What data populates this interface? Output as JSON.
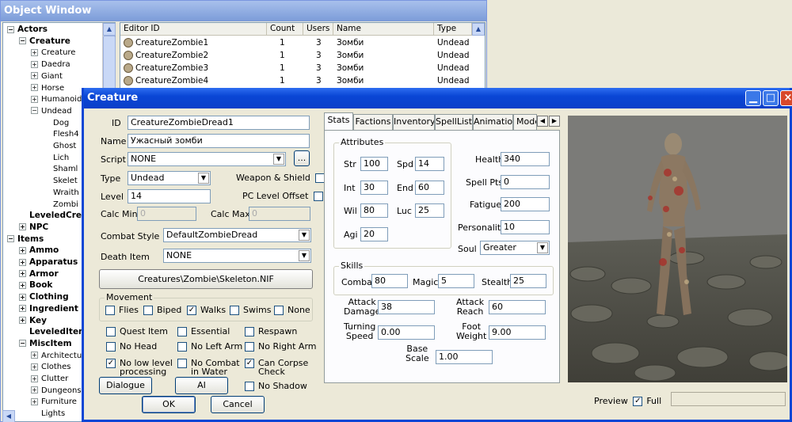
{
  "object_window": {
    "title": "Object Window",
    "tree": [
      {
        "label": "Actors",
        "bold": true,
        "exp": "−"
      },
      {
        "label": "Creature",
        "bold": true,
        "exp": "−"
      },
      {
        "label": "Creature",
        "exp": "+"
      },
      {
        "label": "Daedra",
        "exp": "+"
      },
      {
        "label": "Giant",
        "exp": "+"
      },
      {
        "label": "Horse",
        "exp": "+"
      },
      {
        "label": "Humanoid",
        "exp": "+"
      },
      {
        "label": "Undead",
        "exp": "−"
      },
      {
        "label": "Dog"
      },
      {
        "label": "Flesh4"
      },
      {
        "label": "Ghost"
      },
      {
        "label": "Lich"
      },
      {
        "label": "Shaml"
      },
      {
        "label": "Skelet"
      },
      {
        "label": "Wraith"
      },
      {
        "label": "Zombi"
      },
      {
        "label": "LeveledCrea",
        "bold": true
      },
      {
        "label": "NPC",
        "bold": true,
        "exp": "+"
      },
      {
        "label": "Items",
        "bold": true,
        "exp": "−"
      },
      {
        "label": "Ammo",
        "bold": true,
        "exp": "+"
      },
      {
        "label": "Apparatus",
        "bold": true,
        "exp": "+"
      },
      {
        "label": "Armor",
        "bold": true,
        "exp": "+"
      },
      {
        "label": "Book",
        "bold": true,
        "exp": "+"
      },
      {
        "label": "Clothing",
        "bold": true,
        "exp": "+"
      },
      {
        "label": "Ingredient",
        "bold": true,
        "exp": "+"
      },
      {
        "label": "Key",
        "bold": true,
        "exp": "+"
      },
      {
        "label": "LeveledItem",
        "bold": true
      },
      {
        "label": "MiscItem",
        "bold": true,
        "exp": "−"
      },
      {
        "label": "Architectu",
        "exp": "+"
      },
      {
        "label": "Clothes",
        "exp": "+"
      },
      {
        "label": "Clutter",
        "exp": "+"
      },
      {
        "label": "Dungeons",
        "exp": "+"
      },
      {
        "label": "Furniture",
        "exp": "+"
      },
      {
        "label": "Lights"
      }
    ],
    "columns": [
      "Editor ID",
      "Count",
      "Users",
      "Name",
      "Type"
    ],
    "rows": [
      {
        "id": "CreatureZombie1",
        "count": "1",
        "users": "3",
        "name": "Зомби",
        "type": "Undead"
      },
      {
        "id": "CreatureZombie2",
        "count": "1",
        "users": "3",
        "name": "Зомби",
        "type": "Undead"
      },
      {
        "id": "CreatureZombie3",
        "count": "1",
        "users": "3",
        "name": "Зомби",
        "type": "Undead"
      },
      {
        "id": "CreatureZombie4",
        "count": "1",
        "users": "3",
        "name": "Зомби",
        "type": "Undead"
      }
    ]
  },
  "creature": {
    "title": "Creature",
    "id_label": "ID",
    "id_value": "CreatureZombieDread1",
    "name_label": "Name",
    "name_value": "Ужасный зомби",
    "script_label": "Script",
    "script_value": "NONE",
    "script_btn": "...",
    "type_label": "Type",
    "type_value": "Undead",
    "weapon_shield": "Weapon & Shield",
    "level_label": "Level",
    "level_value": "14",
    "pc_offset": "PC Level Offset",
    "calc_min": "Calc Min",
    "calc_min_value": "0",
    "calc_max": "Calc Max",
    "calc_max_value": "0",
    "combat_style_label": "Combat Style",
    "combat_style_value": "DefaultZombieDread",
    "death_item_label": "Death Item",
    "death_item_value": "NONE",
    "model_path": "Creatures\\Zombie\\Skeleton.NIF",
    "movement_label": "Movement",
    "movement": [
      {
        "label": "Flies",
        "checked": false
      },
      {
        "label": "Biped",
        "checked": false
      },
      {
        "label": "Walks",
        "checked": true
      },
      {
        "label": "Swims",
        "checked": false
      },
      {
        "label": "None",
        "checked": false
      }
    ],
    "flags": {
      "quest_item": {
        "label": "Quest Item",
        "checked": false
      },
      "essential": {
        "label": "Essential",
        "checked": false
      },
      "respawn": {
        "label": "Respawn",
        "checked": false
      },
      "no_head": {
        "label": "No Head",
        "checked": false
      },
      "no_left_arm": {
        "label": "No Left Arm",
        "checked": false
      },
      "no_right_arm": {
        "label": "No Right Arm",
        "checked": false
      },
      "no_low_level_1": "No low level",
      "no_low_level_2": "processing",
      "no_low_level_checked": true,
      "no_combat_1": "No Combat",
      "no_combat_2": "in Water",
      "no_combat_checked": false,
      "corpse_1": "Can Corpse",
      "corpse_2": "Check",
      "corpse_checked": true,
      "no_shadow": {
        "label": "No Shadow",
        "checked": false
      }
    },
    "dialogue_btn": "Dialogue",
    "ai_btn": "AI",
    "ok_btn": "OK",
    "cancel_btn": "Cancel",
    "tabs": [
      "Stats",
      "Factions",
      "Inventory",
      "SpellList",
      "Animation",
      "Mode"
    ],
    "attributes_label": "Attributes",
    "str_label": "Str",
    "str": "100",
    "spd_label": "Spd",
    "spd": "14",
    "int_label": "Int",
    "int": "30",
    "end_label": "End",
    "end": "60",
    "wil_label": "Wil",
    "wil": "80",
    "luc_label": "Luc",
    "luc": "25",
    "agi_label": "Agi",
    "agi": "20",
    "health_label": "Health",
    "health": "340",
    "spell_label": "Spell Pts",
    "spell": "0",
    "fatigue_label": "Fatigue",
    "fatigue": "200",
    "personality_label": "Personality",
    "personality": "10",
    "soul_label": "Soul",
    "soul": "Greater",
    "skills_label": "Skills",
    "combat_label": "Combat",
    "combat": "80",
    "magic_label": "Magic",
    "magic": "5",
    "stealth_label": "Stealth",
    "stealth": "25",
    "attack_damage_1": "Attack",
    "attack_damage_2": "Damage",
    "attack_damage": "38",
    "attack_reach_1": "Attack",
    "attack_reach_2": "Reach",
    "attack_reach": "60",
    "turning_1": "Turning",
    "turning_2": "Speed",
    "turning": "0.00",
    "foot_1": "Foot",
    "foot_2": "Weight",
    "foot": "9.00",
    "base_1": "Base",
    "base_2": "Scale",
    "base": "1.00",
    "preview_label": "Preview",
    "full_label": "Full",
    "full_checked": true
  }
}
